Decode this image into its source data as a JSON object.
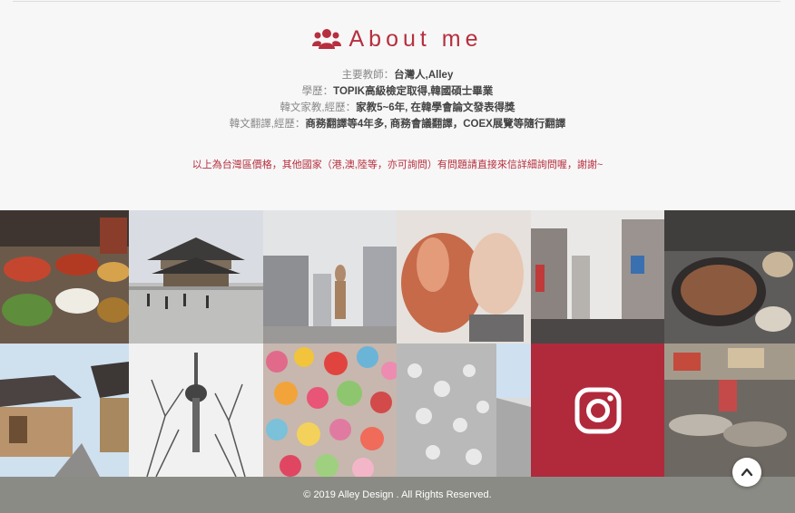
{
  "about": {
    "title": "About me",
    "teacher_label": "主要教師：",
    "teacher_value": "台灣人,Alley",
    "edu_label": "學歷：",
    "edu_value": "TOPIK高級檢定取得,韓國碩士畢業",
    "tutor_label": "韓文家教,經歷：",
    "tutor_value": "家教5~6年, 在韓學會論文發表得獎",
    "translate_label": "韓文翻譯,經歷：",
    "translate_value": "商務翻譯等4年多, 商務會議翻譯，COEX展覽等隨行翻譯",
    "notice": "以上為台灣區價格，其他國家（港,澳,陸等，亦可詢問）有問題請直接來信詳細詢問喔，謝謝~"
  },
  "gallery": {
    "tiles": [
      "market-food",
      "gyeongbokgung-palace",
      "ddp-statue",
      "lobster",
      "myeongdong-street",
      "korean-bbq",
      "hanok-village",
      "namsan-tower",
      "love-locks",
      "wall-sculpture",
      "instagram-link",
      "street-food-market"
    ]
  },
  "footer": {
    "copyright": "© 2019 Alley Design . All Rights Reserved."
  },
  "colors": {
    "accent": "#b62f3f",
    "footer_bg": "#8b8b85",
    "instagram_bg": "#b02a3c"
  }
}
